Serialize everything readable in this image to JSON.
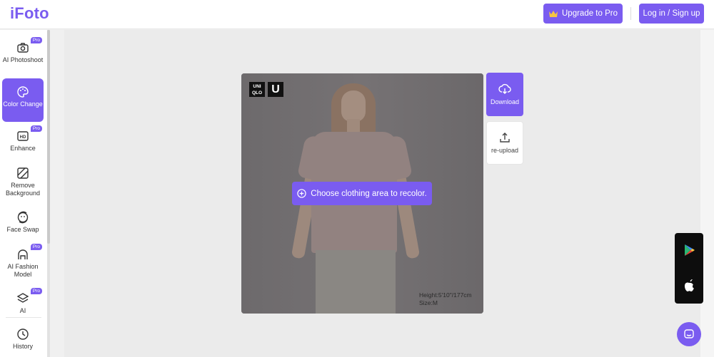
{
  "header": {
    "logo": "iFoto",
    "upgrade_label": "Upgrade to Pro",
    "login_label": "Log in / Sign up"
  },
  "sidebar": {
    "pro_badge": "Pro",
    "items": [
      {
        "label": "AI Photoshoot",
        "icon": "camera-icon",
        "pro": true
      },
      {
        "label": "Color Change",
        "icon": "palette-icon",
        "pro": false,
        "active": true
      },
      {
        "label": "Enhance",
        "icon": "hd-icon",
        "pro": true
      },
      {
        "label": "Remove Background",
        "icon": "remove-bg-icon",
        "pro": false
      },
      {
        "label": "Face Swap",
        "icon": "face-swap-icon",
        "pro": false
      },
      {
        "label": "AI Fashion Model",
        "icon": "fashion-model-icon",
        "pro": true
      },
      {
        "label": "AI",
        "icon": "layers-icon",
        "pro": true
      },
      {
        "label": "History",
        "icon": "clock-icon",
        "pro": false
      }
    ]
  },
  "canvas": {
    "brand_logo_1": "UNI QLO",
    "brand_logo_2": "U",
    "measure_height": "Height:5'10\"/177cm",
    "measure_size": "Size:M",
    "prompt": "Choose clothing area to recolor."
  },
  "actions": {
    "download_label": "Download",
    "reupload_label": "re-upload"
  },
  "colors": {
    "accent": "#7a5cf0",
    "canvas_overlay": "#6a6769"
  }
}
